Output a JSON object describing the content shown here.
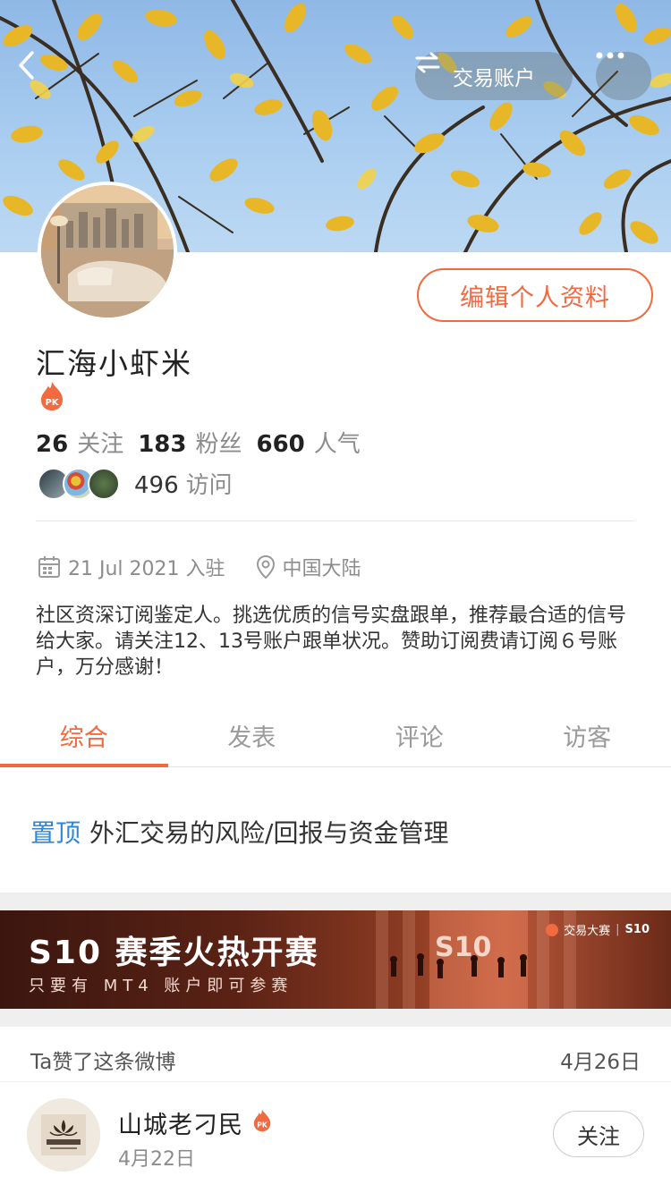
{
  "header": {
    "back_icon": "chevron-left-icon",
    "trade_account_label": "交易账户",
    "trade_icon": "swap-arrows-icon",
    "more_icon": "more-dots-icon"
  },
  "profile": {
    "edit_label": "编辑个人资料",
    "username": "汇海小虾米",
    "badge": "PK",
    "stats": {
      "follow_count": "26",
      "follow_label": "关注",
      "fans_count": "183",
      "fans_label": "粉丝",
      "popularity_count": "660",
      "popularity_label": "人气"
    },
    "visits_count": "496",
    "visits_label": "访问",
    "joined": "21 Jul 2021 入驻",
    "location": "中国大陆",
    "bio": "社区资深订阅鉴定人。挑选优质的信号实盘跟单，推荐最合适的信号给大家。请关注12、13号账户跟单状况。赞助订阅费请订阅６号账户，万分感谢！"
  },
  "tabs": [
    {
      "label": "综合",
      "active": true
    },
    {
      "label": "发表",
      "active": false
    },
    {
      "label": "评论",
      "active": false
    },
    {
      "label": "访客",
      "active": false
    }
  ],
  "pinned": {
    "tag": "置顶",
    "title": "外汇交易的风险/回报与资金管理"
  },
  "ad": {
    "title": "S10 赛季火热开赛",
    "subtitle": "只要有 MT4 账户即可参赛",
    "brand": "交易大赛",
    "brand_season": "S10",
    "big_mark": "S10"
  },
  "feed": {
    "liked_label": "Ta赞了这条微博",
    "liked_date": "4月26日",
    "post": {
      "author": "山城老刁民",
      "date": "4月22日",
      "follow_label": "关注"
    }
  },
  "colors": {
    "accent": "#f26a3f",
    "link": "#2d86d9"
  }
}
